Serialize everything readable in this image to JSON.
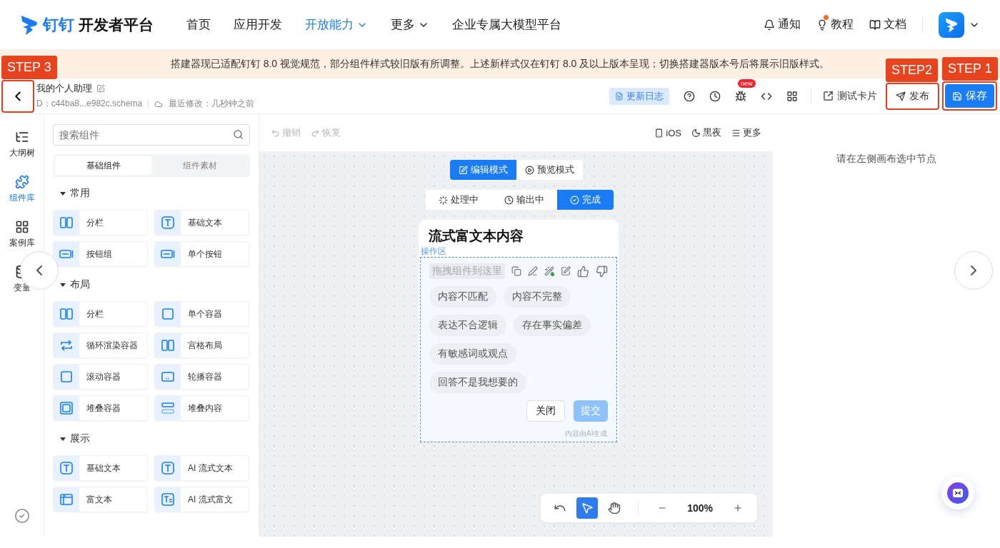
{
  "header": {
    "logo": "钉钉",
    "brand": "开发者平台",
    "nav": [
      {
        "label": "首页",
        "selected": false,
        "dropdown": false
      },
      {
        "label": "应用开发",
        "selected": false,
        "dropdown": false
      },
      {
        "label": "开放能力",
        "selected": true,
        "dropdown": true
      },
      {
        "label": "更多",
        "selected": false,
        "dropdown": true
      },
      {
        "label": "企业专属大模型平台",
        "selected": false,
        "dropdown": false
      }
    ],
    "links": [
      {
        "label": "通知",
        "kind": "bell",
        "dot": false
      },
      {
        "label": "教程",
        "kind": "bulb",
        "dot": true
      },
      {
        "label": "文档",
        "kind": "book",
        "dot": false
      }
    ]
  },
  "notice": "搭建器现已适配钉钉 8.0 视觉规范，部分组件样式较旧版有所调整。上述新样式仅在钉钉 8.0 及以上版本呈现；切换搭建器版本号后将展示旧版样式。",
  "project": {
    "back_step": "STEP 3",
    "title": "我的个人助理",
    "id": "D：c44ba8...e982c.schema",
    "modified": "最近修改：几秒钟之前"
  },
  "toolbar": {
    "changelog": "更新日志",
    "new_badge": "new",
    "test_card": "测试卡片",
    "publish": {
      "label": "发布",
      "step": "STEP2"
    },
    "save": {
      "label": "保存",
      "step": "STEP 1"
    }
  },
  "rail": [
    {
      "label": "大纲树",
      "kind": "tree",
      "selected": false
    },
    {
      "label": "组件库",
      "kind": "puzzle",
      "selected": true
    },
    {
      "label": "案例库",
      "kind": "grid",
      "selected": false
    },
    {
      "label": "变量",
      "kind": "database",
      "selected": false
    }
  ],
  "panel": {
    "search": {
      "placeholder": "搜索组件"
    },
    "tabs": [
      {
        "label": "基础组件",
        "selected": true
      },
      {
        "label": "组件素材",
        "selected": false
      }
    ],
    "groups": [
      {
        "title": "常用",
        "expanded": true,
        "items": [
          {
            "label": "分栏",
            "kind": "columns"
          },
          {
            "label": "基础文本",
            "kind": "text"
          },
          {
            "label": "按钮组",
            "kind": "button"
          },
          {
            "label": "单个按钮",
            "kind": "button"
          }
        ]
      },
      {
        "title": "布局",
        "expanded": true,
        "items": [
          {
            "label": "分栏",
            "kind": "columns"
          },
          {
            "label": "单个容器",
            "kind": "box"
          },
          {
            "label": "循环渲染容器",
            "kind": "loop"
          },
          {
            "label": "宫格布局",
            "kind": "columns"
          },
          {
            "label": "滚动容器",
            "kind": "box"
          },
          {
            "label": "轮播容器",
            "kind": "carousel"
          },
          {
            "label": "堆叠容器",
            "kind": "stack"
          },
          {
            "label": "堆叠内容",
            "kind": "layers"
          }
        ]
      },
      {
        "title": "展示",
        "expanded": true,
        "items": [
          {
            "label": "基础文本",
            "kind": "text"
          },
          {
            "label": "AI 流式文本",
            "kind": "text"
          },
          {
            "label": "富文本",
            "kind": "richtext"
          },
          {
            "label": "AI 流式富文",
            "kind": "airich"
          }
        ]
      }
    ]
  },
  "canvas": {
    "undo": "撤销",
    "redo": "恢复",
    "device": "iOS",
    "theme": "黑夜",
    "more": "更多",
    "modes": [
      {
        "label": "编辑模式",
        "kind": "edit",
        "selected": true
      },
      {
        "label": "预览模式",
        "kind": "preview",
        "selected": false
      }
    ],
    "states": [
      {
        "label": "处理中",
        "kind": "loading",
        "selected": false
      },
      {
        "label": "输出中",
        "kind": "clock",
        "selected": false
      },
      {
        "label": "完成",
        "kind": "done",
        "selected": true
      }
    ],
    "card": {
      "title": "流式富文本内容",
      "zone_label": "操作区",
      "drop_hint": "拖拽组件到这里",
      "reasons": [
        "内容不匹配",
        "内容不完整",
        "表达不合逻辑",
        "存在事实偏差",
        "有敏感词或观点",
        "回答不是我想要的"
      ],
      "close": "关闭",
      "submit": "提交",
      "footnote": "内容由AI生成"
    },
    "tools": [
      {
        "kind": "undo",
        "selected": false
      },
      {
        "kind": "pointer",
        "selected": true
      },
      {
        "kind": "hand",
        "selected": false
      }
    ],
    "zoom": "100%"
  },
  "inspector": {
    "empty_text": "请在左侧画布选中节点"
  }
}
